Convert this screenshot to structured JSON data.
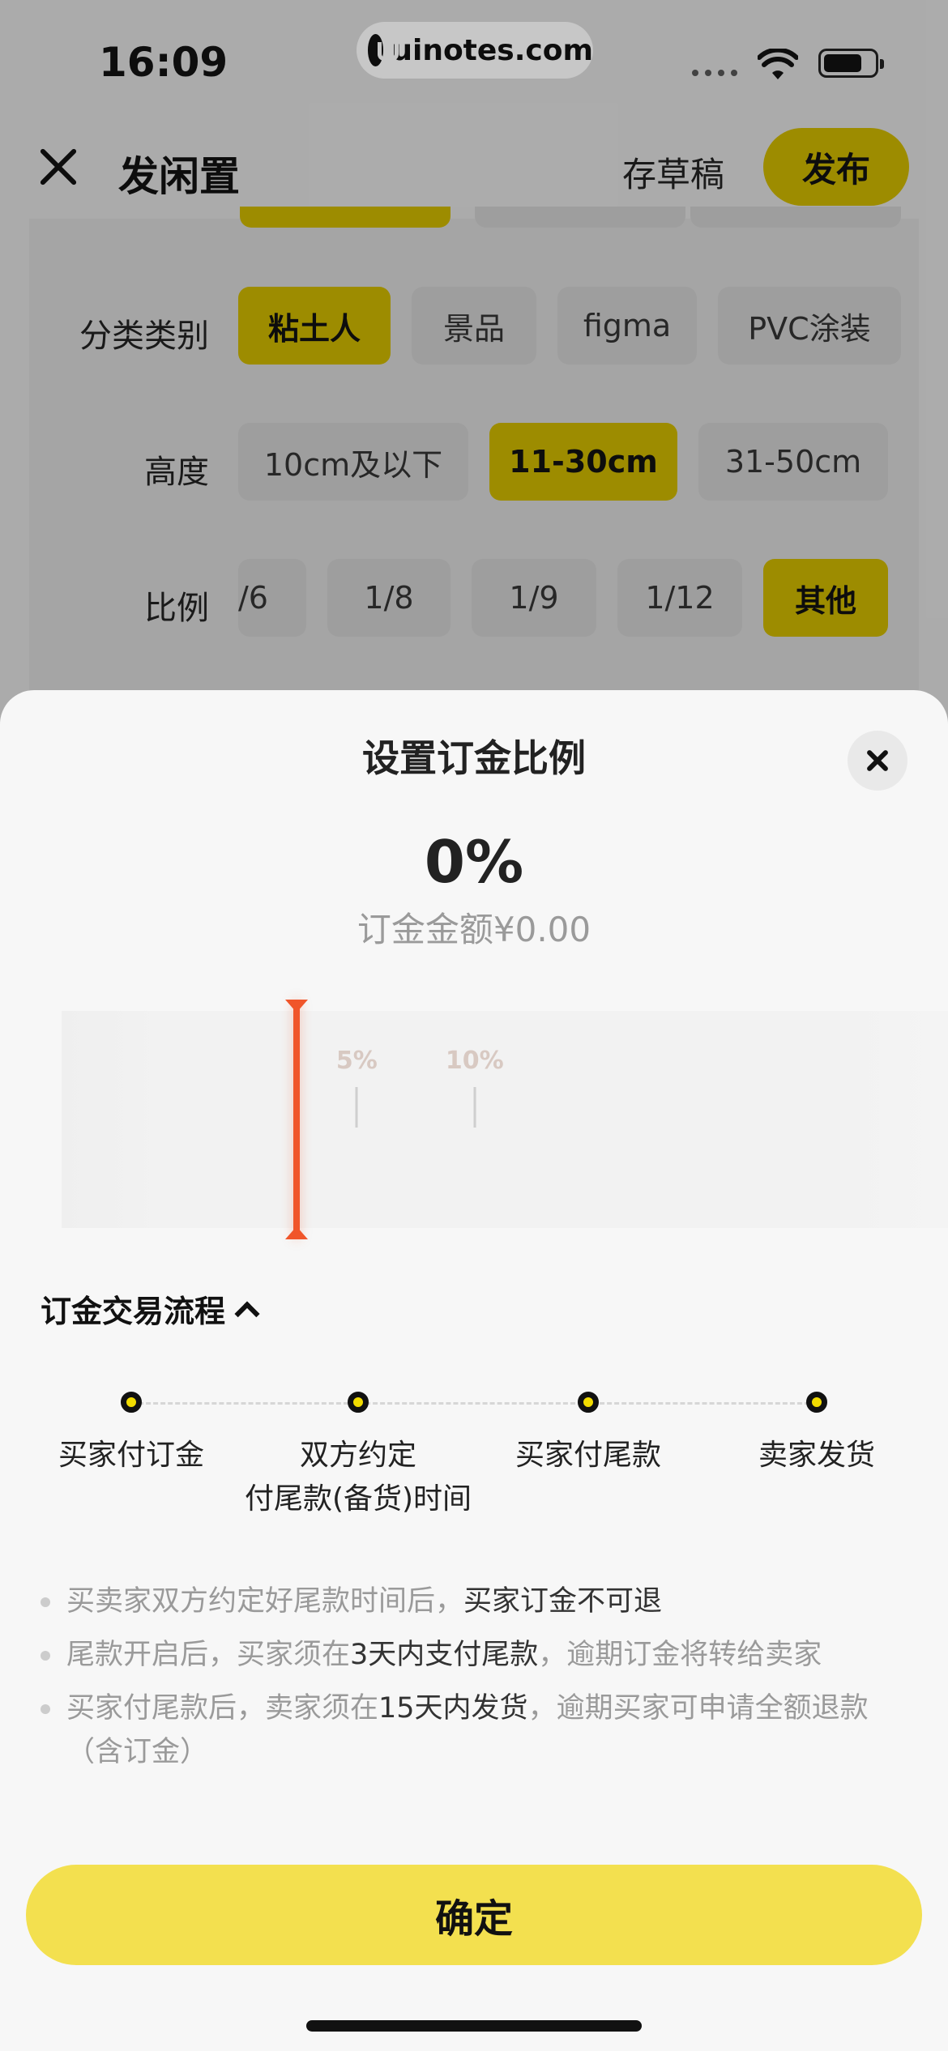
{
  "status_bar": {
    "time": "16:09",
    "watermark": "uinotes.com"
  },
  "nav": {
    "title": "发闲置",
    "draft_label": "存草稿",
    "publish_label": "发布"
  },
  "form": {
    "category": {
      "label": "分类类别",
      "options": [
        "粘土人",
        "景品",
        "figma",
        "PVC涂装"
      ],
      "selected": "粘土人"
    },
    "height": {
      "label": "高度",
      "options": [
        "10cm及以下",
        "11-30cm",
        "31-50cm"
      ],
      "selected": "11-30cm"
    },
    "ratio": {
      "label": "比例",
      "options": [
        "/6",
        "1/8",
        "1/9",
        "1/12",
        "其他"
      ],
      "selected": "其他"
    }
  },
  "sheet": {
    "title": "设置订金比例",
    "percent": "0%",
    "amount": "订金金额¥0.00",
    "slider": {
      "value_percent": 0,
      "ticks": [
        "5%",
        "10%"
      ]
    },
    "flow_title": "订金交易流程",
    "steps": [
      {
        "line1": "买家付订金",
        "line2": ""
      },
      {
        "line1": "双方约定",
        "line2": "付尾款(备货)时间"
      },
      {
        "line1": "买家付尾款",
        "line2": ""
      },
      {
        "line1": "卖家发货",
        "line2": ""
      }
    ],
    "rules": [
      {
        "part1": "买卖家双方约定好尾款时间后，",
        "dark1": "买家订金不可退",
        "part2": "",
        "dark2": "",
        "part3": ""
      },
      {
        "part1": "尾款开启后，买家须在",
        "dark1": "3天内支付尾款",
        "part2": "，逾期订金将转给卖家",
        "dark2": "",
        "part3": ""
      },
      {
        "part1": "买家付尾款后，卖家须在",
        "dark1": "15天内发货",
        "part2": "，逾期买家可申请全额退款（含订金）",
        "dark2": "",
        "part3": ""
      }
    ],
    "confirm_label": "确定"
  },
  "colors": {
    "accent_yellow": "#f3e04f",
    "selected_chip": "#c9b400",
    "slider_indicator": "#f0552a"
  }
}
